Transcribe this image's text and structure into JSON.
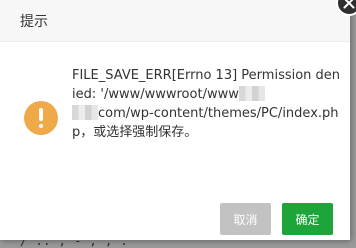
{
  "background": {
    "page_text": "          /  ..  ,  -  ,    ,   ."
  },
  "dialog": {
    "title": "提示",
    "message": {
      "line1": "FILE_SAVE_ERR[Errno 13] Permission denied: '/www/wwwroot/www",
      "line2": "com/wp-content/themes/PC/index.php，或选择强制保存。"
    },
    "buttons": {
      "cancel": "取消",
      "confirm": "确定"
    }
  },
  "colors": {
    "warning": "#f0a948",
    "confirm": "#1ea53a",
    "cancel_disabled": "#c2c2c2"
  },
  "icons": {
    "close": "close-icon",
    "warning": "exclamation-icon"
  }
}
